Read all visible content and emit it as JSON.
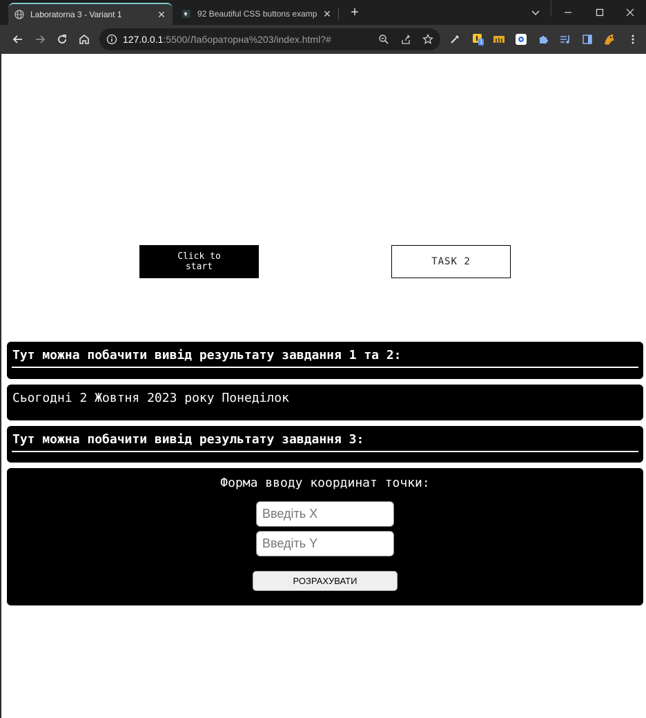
{
  "browser": {
    "tabs": [
      {
        "title": "Laboratorna 3 - Variant 1",
        "active": true
      },
      {
        "title": "92 Beautiful CSS buttons examp",
        "active": false
      }
    ],
    "new_tab_label": "+",
    "url_host": "127.0.0.1",
    "url_rest": ":5500/Лабораторна%203/index.html?#"
  },
  "page": {
    "start_button": "Click to start",
    "task2_button": "TASK 2",
    "result_1_2_heading": "Тут можна побачити вивід результату завдання 1 та 2:",
    "date_output": "Сьогодні 2 Жовтня 2023 року Понеділок",
    "result_3_heading": "Тут можна побачити вивід результату завдання 3:",
    "form": {
      "title": "Форма вводу координат точки:",
      "x_placeholder": "Введіть X",
      "y_placeholder": "Введіть Y",
      "calculate_button": "РОЗРАХУВАТИ"
    }
  },
  "colors": {
    "accent_tab": "#7cc9cf",
    "chrome_dark": "#1f1f1f",
    "toolbar": "#353535",
    "panel": "#000000"
  },
  "extensions_badge": "1"
}
